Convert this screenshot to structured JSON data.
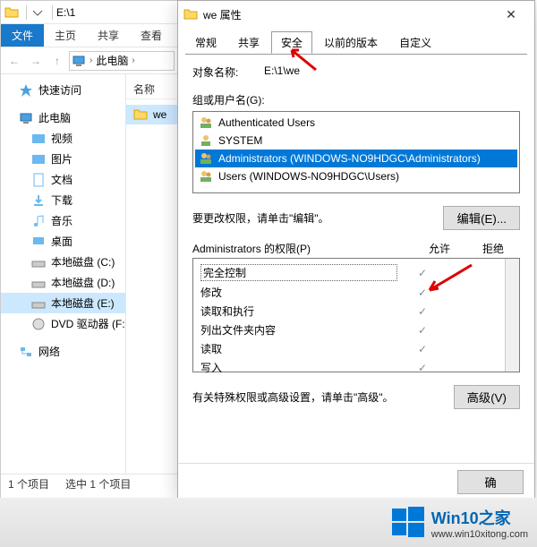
{
  "explorer": {
    "title_path": "E:\\1",
    "ribbon": {
      "file": "文件",
      "home": "主页",
      "share": "共享",
      "view": "查看"
    },
    "crumb": "此电脑",
    "tree": {
      "quick": "快速访问",
      "pc": "此电脑",
      "subs": [
        "视频",
        "图片",
        "文档",
        "下载",
        "音乐",
        "桌面",
        "本地磁盘 (C:)",
        "本地磁盘 (D:)",
        "本地磁盘 (E:)",
        "DVD 驱动器 (F:) Bo"
      ],
      "network": "网络"
    },
    "list": {
      "header": "名称",
      "item": "we"
    },
    "status": {
      "count": "1 个项目",
      "sel": "选中 1 个项目"
    }
  },
  "props": {
    "title": "we 属性",
    "tabs": [
      "常规",
      "共享",
      "安全",
      "以前的版本",
      "自定义"
    ],
    "object_label": "对象名称:",
    "object_value": "E:\\1\\we",
    "group_label": "组或用户名(G):",
    "users": [
      "Authenticated Users",
      "SYSTEM",
      "Administrators (WINDOWS-NO9HDGC\\Administrators)",
      "Users (WINDOWS-NO9HDGC\\Users)"
    ],
    "edit_hint": "要更改权限，请单击\"编辑\"。",
    "edit_btn": "编辑(E)...",
    "perm_title": "Administrators 的权限(P)",
    "perm_allow": "允许",
    "perm_deny": "拒绝",
    "perms": [
      "完全控制",
      "修改",
      "读取和执行",
      "列出文件夹内容",
      "读取",
      "写入"
    ],
    "adv_hint": "有关特殊权限或高级设置，请单击\"高级\"。",
    "adv_btn": "高级(V)",
    "ok_btn": "确"
  },
  "watermark": {
    "brand": "Win10之家",
    "url": "www.win10xitong.com"
  }
}
